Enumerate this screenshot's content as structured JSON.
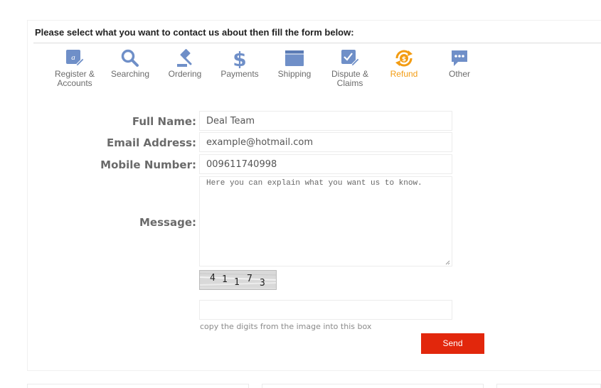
{
  "heading": "Please select what you want to contact us about then fill the form below:",
  "categories": [
    {
      "label_line1": "Register &",
      "label_line2": "Accounts",
      "icon": "register-edit-icon"
    },
    {
      "label_line1": "Searching",
      "label_line2": "",
      "icon": "search-icon"
    },
    {
      "label_line1": "Ordering",
      "label_line2": "",
      "icon": "gavel-icon"
    },
    {
      "label_line1": "Payments",
      "label_line2": "",
      "icon": "dollar-icon"
    },
    {
      "label_line1": "Shipping",
      "label_line2": "",
      "icon": "package-icon"
    },
    {
      "label_line1": "Dispute &",
      "label_line2": "Claims",
      "icon": "dispute-edit-icon"
    },
    {
      "label_line1": "Refund",
      "label_line2": "",
      "icon": "refund-icon"
    },
    {
      "label_line1": "Other",
      "label_line2": "",
      "icon": "chat-icon"
    }
  ],
  "active_category": "Refund",
  "form": {
    "full_name_label": "Full Name:",
    "full_name_value": "Deal Team",
    "email_label": "Email Address:",
    "email_value": "example@hotmail.com",
    "mobile_label": "Mobile Number:",
    "mobile_value": "009611740998",
    "message_label": "Message:",
    "message_placeholder": "Here you can explain what you want us to know.",
    "captcha_digits": [
      "4",
      "1",
      "1",
      "7",
      "3"
    ],
    "captcha_input_value": "",
    "captcha_hint": "copy the digits from the image into this box",
    "send_label": "Send"
  },
  "colors": {
    "icon_blue": "#6f8fc8",
    "active_orange": "#f39c12",
    "send_red": "#e2270c"
  }
}
